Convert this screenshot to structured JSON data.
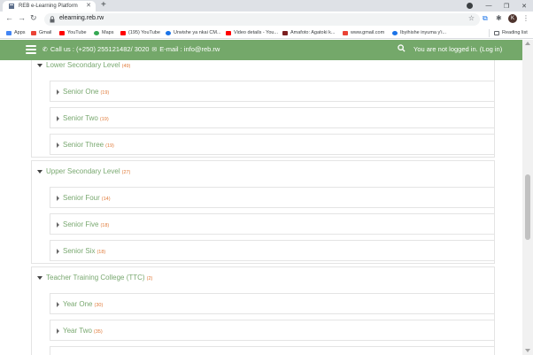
{
  "browser": {
    "tab_title": "REB e-Learning Platform",
    "url": "elearning.reb.rw",
    "avatar_letter": "K",
    "bookmarks": [
      {
        "label": "Apps",
        "icon": "apps-grid-icon",
        "color": "#4285f4"
      },
      {
        "label": "Gmail",
        "icon": "gmail-icon",
        "color": "#ea4335"
      },
      {
        "label": "YouTube",
        "icon": "youtube-icon",
        "color": "#ff0000"
      },
      {
        "label": "Maps",
        "icon": "maps-pin-icon",
        "color": "#34a853"
      },
      {
        "label": "(195) YouTube",
        "icon": "youtube-icon",
        "color": "#ff0000"
      },
      {
        "label": "Urwishe ya nkai CM...",
        "icon": "globe-icon",
        "color": "#1a73e8"
      },
      {
        "label": "Video details - You...",
        "icon": "youtube-icon",
        "color": "#ff0000"
      },
      {
        "label": "Amafoto: Agatoki k...",
        "icon": "photo-icon",
        "color": "#7b1f1f"
      },
      {
        "label": "www.gmail.com",
        "icon": "gmail-icon",
        "color": "#ea4335"
      },
      {
        "label": "Ibyihishe inyuma y'i...",
        "icon": "globe-icon",
        "color": "#1a73e8"
      }
    ],
    "reading_list": "Reading list"
  },
  "navbar": {
    "contact_phone": "Call us : (+250) 255121482/ 3020",
    "contact_email": "E-mail : info@reb.rw",
    "login_text": "You are not logged in. (Log in)",
    "color": "#74a86a"
  },
  "levels": [
    {
      "title": "Lower Secondary Level",
      "count": "(49)",
      "items": [
        {
          "label": "Senior One",
          "count": "(19)"
        },
        {
          "label": "Senior Two",
          "count": "(19)"
        },
        {
          "label": "Senior Three",
          "count": "(19)"
        }
      ]
    },
    {
      "title": "Upper Secondary Level",
      "count": "(27)",
      "items": [
        {
          "label": "Senior Four",
          "count": "(14)"
        },
        {
          "label": "Senior Five",
          "count": "(18)"
        },
        {
          "label": "Senior Six",
          "count": "(18)"
        }
      ]
    },
    {
      "title": "Teacher Training College (TTC)",
      "count": "(2)",
      "items": [
        {
          "label": "Year One",
          "count": "(30)"
        },
        {
          "label": "Year Two",
          "count": "(35)"
        }
      ]
    }
  ],
  "colors": {
    "level_text": "#79a870",
    "count_text": "#e07b3a"
  }
}
